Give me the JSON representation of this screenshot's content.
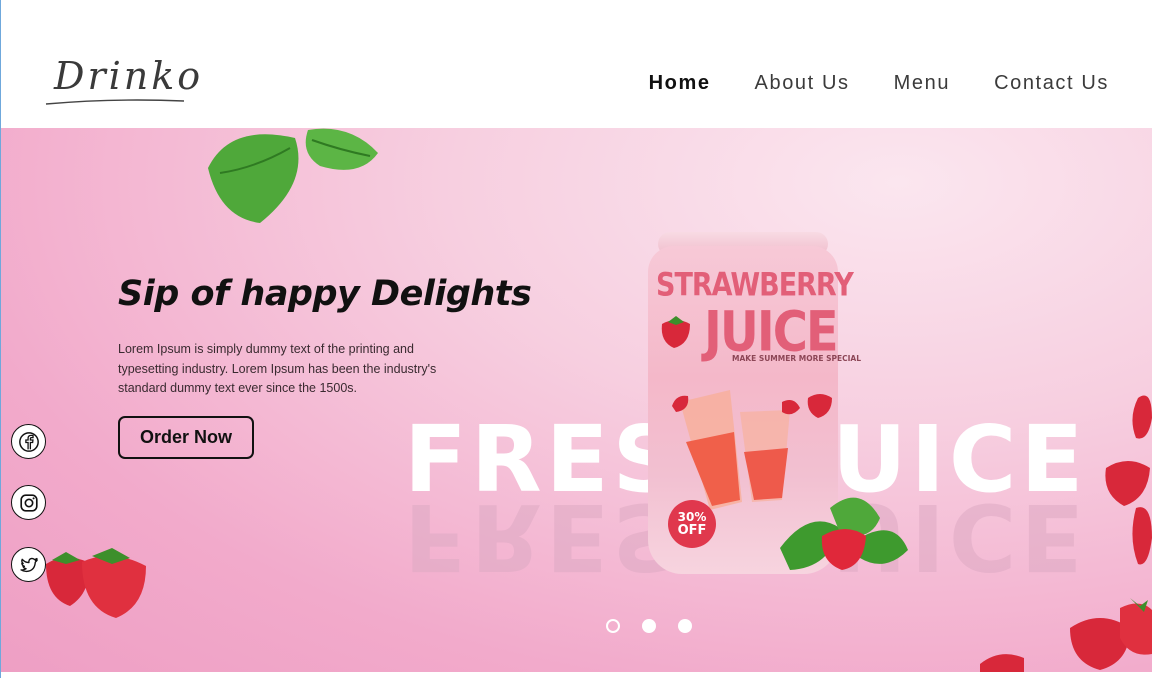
{
  "header": {
    "logo_text": "Drinko",
    "nav": [
      {
        "label": "Home",
        "active": true
      },
      {
        "label": "About Us",
        "active": false
      },
      {
        "label": "Menu",
        "active": false
      },
      {
        "label": "Contact Us",
        "active": false
      }
    ]
  },
  "hero": {
    "headline": "Sip of happy Delights",
    "description": "Lorem Ipsum is simply dummy text of the printing and typesetting industry. Lorem Ipsum has been the industry's standard dummy text ever since the 1500s.",
    "cta_label": "Order Now",
    "big_word_left": "FRES",
    "big_word_right": "UICE",
    "can": {
      "title_line1": "STRAWBERRY",
      "title_line2": "JUICE",
      "tagline": "MAKE SUMMER MORE SPECIAL",
      "badge_percent": "30%",
      "badge_off": "OFF"
    },
    "carousel": {
      "slides": 3,
      "active_index": 0
    }
  },
  "social": [
    {
      "icon": "facebook-icon"
    },
    {
      "icon": "instagram-icon"
    },
    {
      "icon": "twitter-icon"
    }
  ],
  "colors": {
    "accent": "#111111",
    "hero_pink": "#f2aacb",
    "can_title": "#e25f78",
    "badge_red": "#e0384d"
  }
}
